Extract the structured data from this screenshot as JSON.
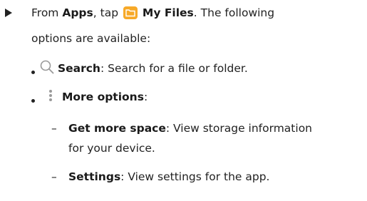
{
  "step": {
    "from": "From ",
    "apps": "Apps",
    "sep": ", tap ",
    "myfiles": "My Files",
    "rest": ". The following",
    "line2": "options are available:"
  },
  "items": [
    {
      "label": "Search",
      "text": ": Search for a file or folder.",
      "icon": "search-icon"
    },
    {
      "label": "More options",
      "text": ":",
      "icon": "more-options-icon"
    }
  ],
  "subitems": [
    {
      "dash": "–",
      "label": "Get more space",
      "text": ": View storage information",
      "text2": "for your device."
    },
    {
      "dash": "–",
      "label": "Settings",
      "text": ": View settings for the app."
    }
  ],
  "colors": {
    "folder": "#f7a928",
    "icon_gray": "#9a9a9a"
  }
}
